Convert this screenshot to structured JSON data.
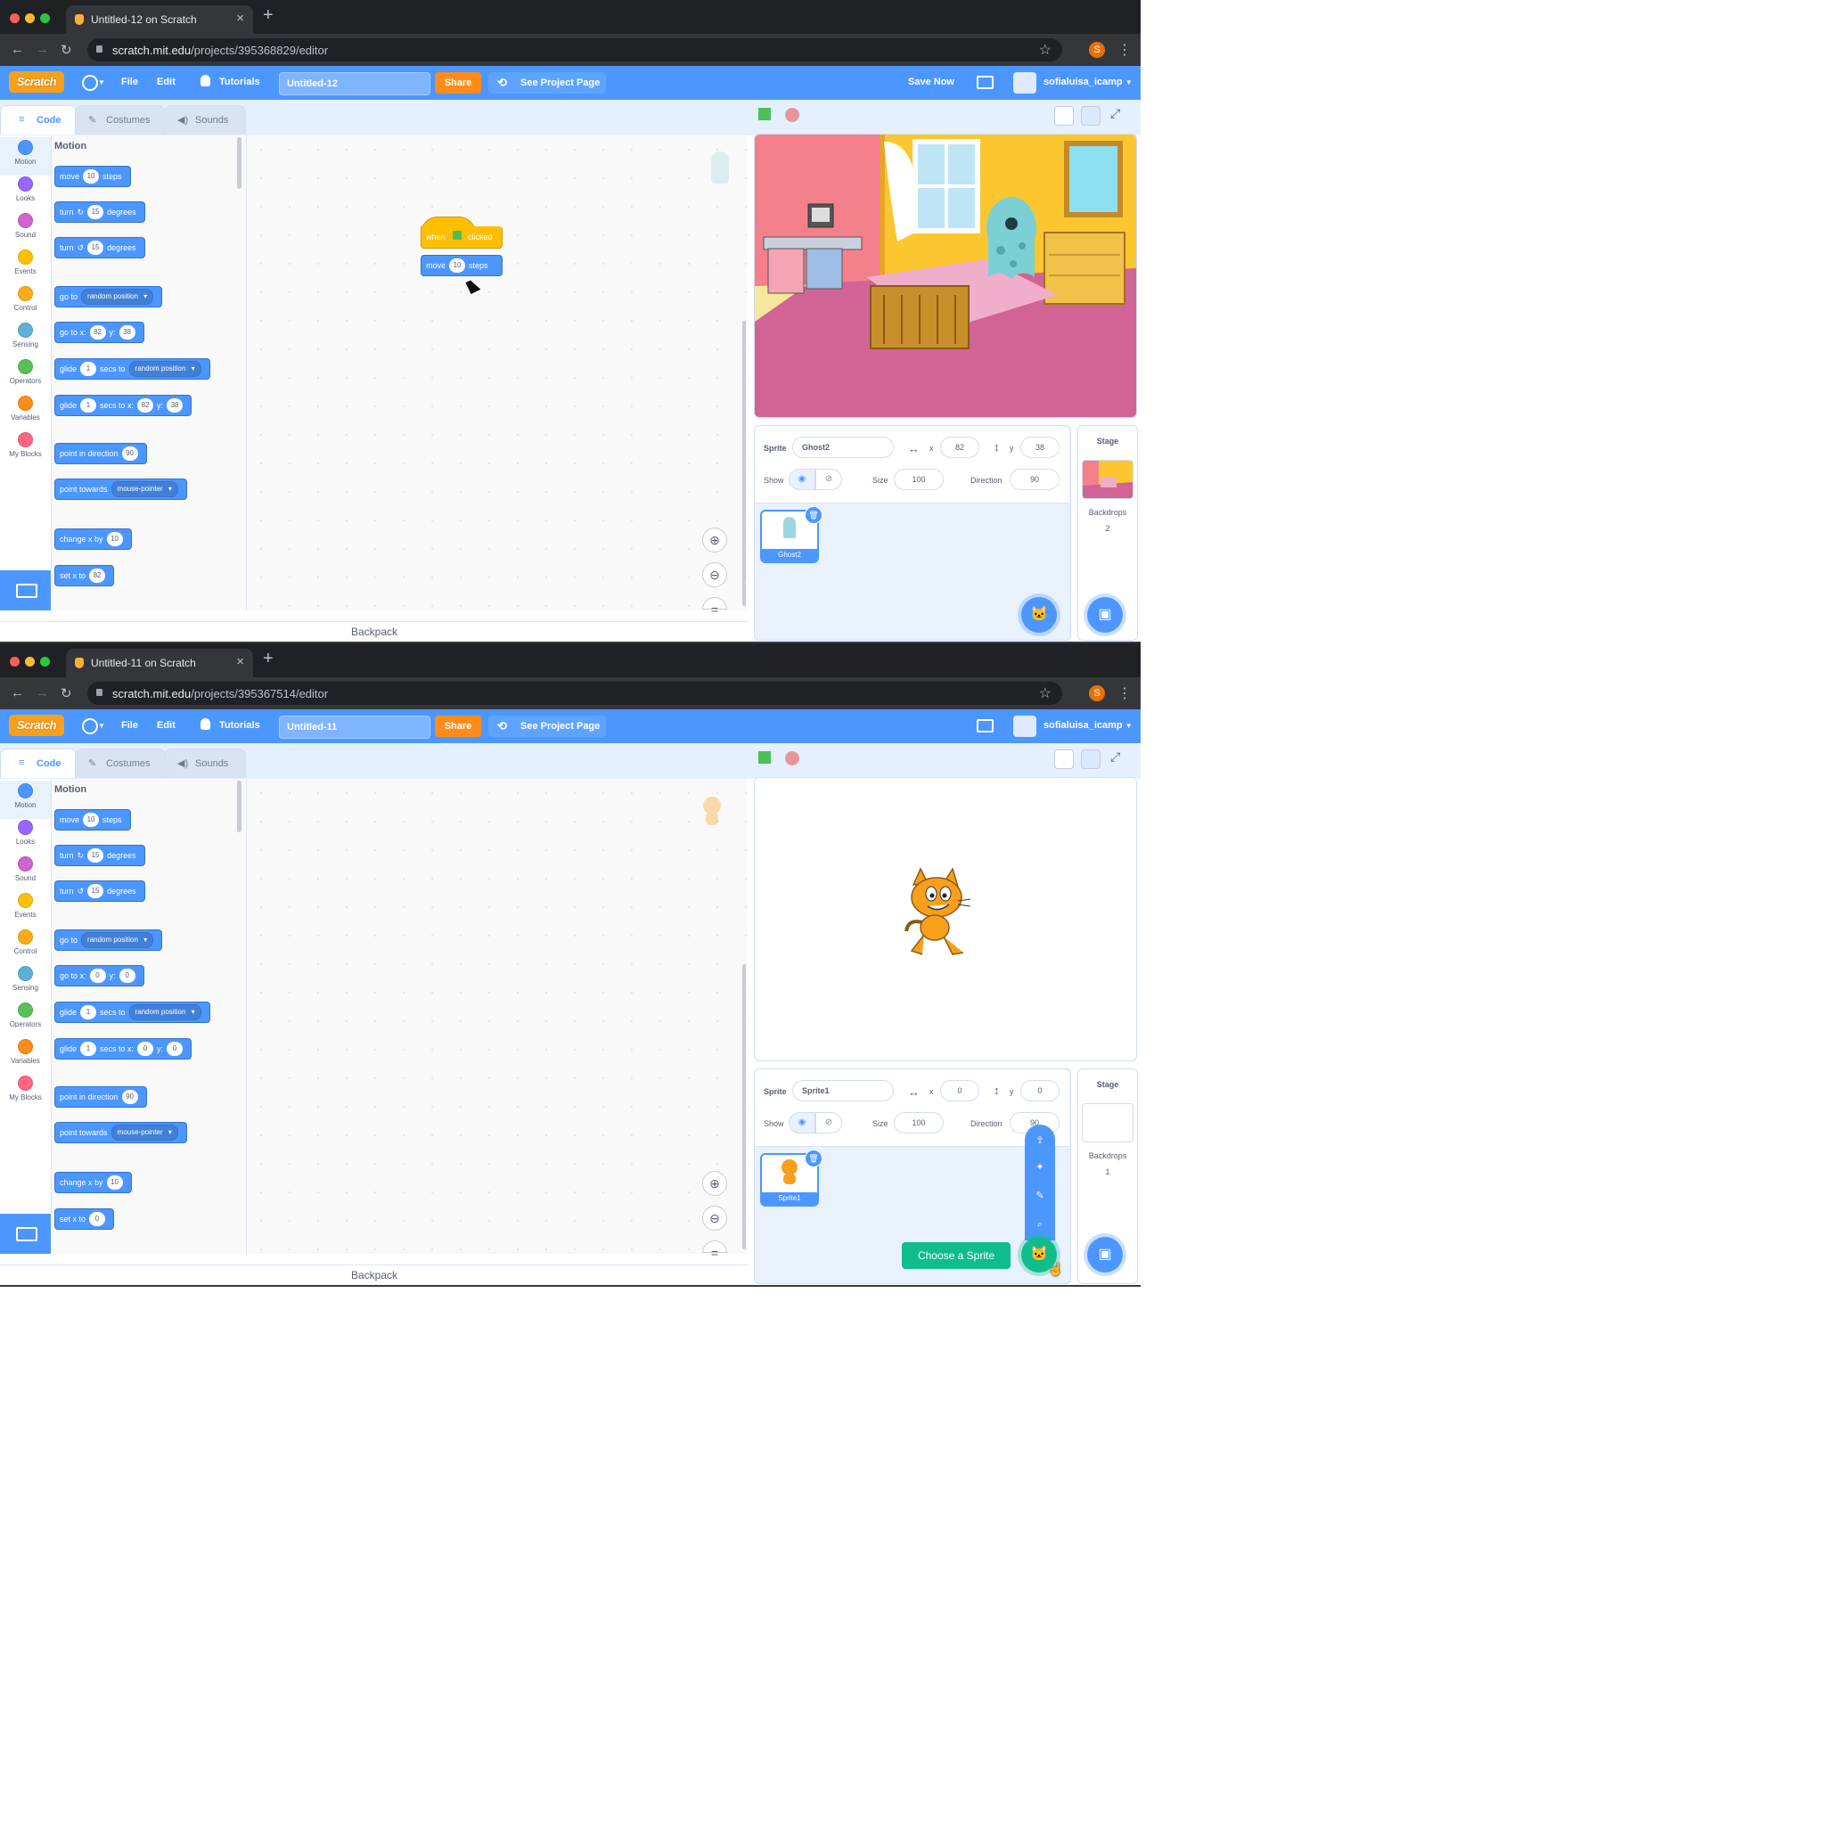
{
  "windows": [
    {
      "tab_title": "Untitled-12 on Scratch",
      "url_host": "scratch.mit.edu",
      "url_path": "/projects/395368829/editor",
      "profile_initial": "S",
      "menu": {
        "file": "File",
        "edit": "Edit",
        "tutorials": "Tutorials",
        "project_title": "Untitled-12",
        "share": "Share",
        "see_project_page": "See Project Page",
        "save_now": "Save Now",
        "username": "sofialuisa_icamp"
      },
      "tabs": {
        "code": "Code",
        "costumes": "Costumes",
        "sounds": "Sounds"
      },
      "categories": [
        "Motion",
        "Looks",
        "Sound",
        "Events",
        "Control",
        "Sensing",
        "Operators",
        "Variables",
        "My Blocks"
      ],
      "palette": {
        "title": "Motion",
        "move": "move",
        "steps": "steps",
        "steps_val": "10",
        "turn": "turn",
        "degrees": "degrees",
        "deg_val": "15",
        "goto": "go to",
        "random_position": "random position",
        "gotoxy": "go to x:",
        "y": "y:",
        "x_val": "82",
        "y_val": "38",
        "glide": "glide",
        "secs_to": "secs to",
        "secs_to_x": "secs to x:",
        "glide_val": "1",
        "point_in_direction": "point in direction",
        "dir_val": "90",
        "point_towards": "point towards",
        "mouse_pointer": "mouse-pointer",
        "change_x_by": "change x by",
        "change_val": "10",
        "set_x_to": "set x to",
        "setx_val": "82"
      },
      "script": {
        "when": "when",
        "clicked": "clicked",
        "move": "move",
        "steps_val": "10",
        "steps": "steps"
      },
      "backpack": "Backpack",
      "sprite": {
        "label": "Sprite",
        "name": "Ghost2",
        "x_label": "x",
        "x": "82",
        "y_label": "y",
        "y": "38",
        "show": "Show",
        "size_label": "Size",
        "size": "100",
        "direction_label": "Direction",
        "direction": "90"
      },
      "thumb_name": "Ghost2",
      "stage_panel": {
        "title": "Stage",
        "backdrops_label": "Backdrops",
        "backdrops_count": "2"
      }
    },
    {
      "tab_title": "Untitled-11 on Scratch",
      "url_host": "scratch.mit.edu",
      "url_path": "/projects/395367514/editor",
      "profile_initial": "S",
      "menu": {
        "file": "File",
        "edit": "Edit",
        "tutorials": "Tutorials",
        "project_title": "Untitled-11",
        "share": "Share",
        "see_project_page": "See Project Page",
        "username": "sofialuisa_icamp"
      },
      "tabs": {
        "code": "Code",
        "costumes": "Costumes",
        "sounds": "Sounds"
      },
      "categories": [
        "Motion",
        "Looks",
        "Sound",
        "Events",
        "Control",
        "Sensing",
        "Operators",
        "Variables",
        "My Blocks"
      ],
      "palette": {
        "title": "Motion",
        "move": "move",
        "steps": "steps",
        "steps_val": "10",
        "turn": "turn",
        "degrees": "degrees",
        "deg_val": "15",
        "goto": "go to",
        "random_position": "random position",
        "gotoxy": "go to x:",
        "y": "y:",
        "x_val": "0",
        "y_val": "0",
        "glide": "glide",
        "secs_to": "secs to",
        "secs_to_x": "secs to x:",
        "glide_val": "1",
        "point_in_direction": "point in direction",
        "dir_val": "90",
        "point_towards": "point towards",
        "mouse_pointer": "mouse-pointer",
        "change_x_by": "change x by",
        "change_val": "10",
        "set_x_to": "set x to",
        "setx_val": "0"
      },
      "backpack": "Backpack",
      "sprite": {
        "label": "Sprite",
        "name": "Sprite1",
        "x_label": "x",
        "x": "0",
        "y_label": "y",
        "y": "0",
        "show": "Show",
        "size_label": "Size",
        "size": "100",
        "direction_label": "Direction",
        "direction": "90"
      },
      "thumb_name": "Sprite1",
      "stage_panel": {
        "title": "Stage",
        "backdrops_label": "Backdrops",
        "backdrops_count": "1"
      },
      "choose_sprite_tooltip": "Choose a Sprite"
    }
  ],
  "colors": {
    "scratch_blue": "#4c97ff",
    "share_orange": "#ff8c1a",
    "events_yellow": "#ffbf00",
    "sprite_green": "#0fbd8c"
  }
}
